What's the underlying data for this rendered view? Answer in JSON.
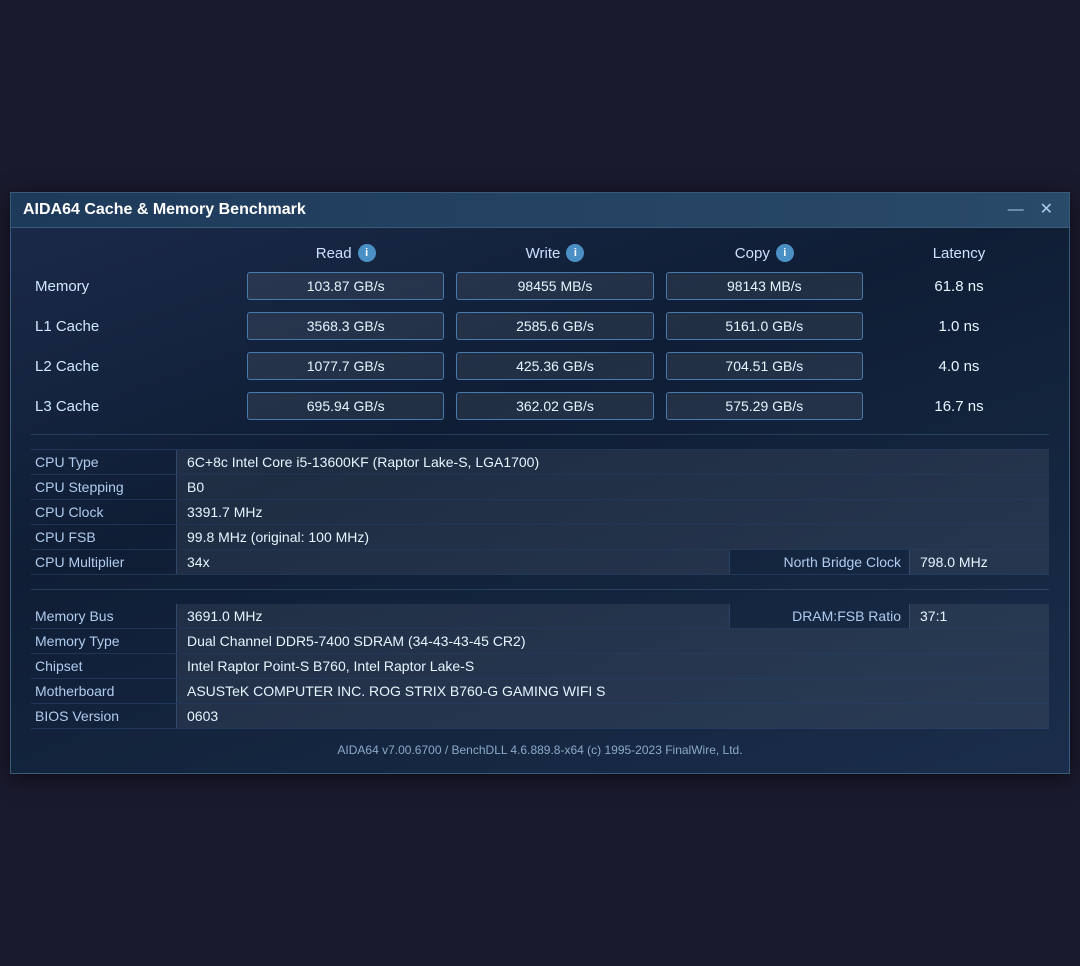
{
  "window": {
    "title": "AIDA64 Cache & Memory Benchmark"
  },
  "header": {
    "col_label": "",
    "read_label": "Read",
    "write_label": "Write",
    "copy_label": "Copy",
    "latency_label": "Latency"
  },
  "rows": [
    {
      "label": "Memory",
      "read": "103.87 GB/s",
      "write": "98455 MB/s",
      "copy": "98143 MB/s",
      "latency": "61.8 ns"
    },
    {
      "label": "L1 Cache",
      "read": "3568.3 GB/s",
      "write": "2585.6 GB/s",
      "copy": "5161.0 GB/s",
      "latency": "1.0 ns"
    },
    {
      "label": "L2 Cache",
      "read": "1077.7 GB/s",
      "write": "425.36 GB/s",
      "copy": "704.51 GB/s",
      "latency": "4.0 ns"
    },
    {
      "label": "L3 Cache",
      "read": "695.94 GB/s",
      "write": "362.02 GB/s",
      "copy": "575.29 GB/s",
      "latency": "16.7 ns"
    }
  ],
  "cpu_type_label": "CPU Type",
  "cpu_type_value": "6C+8c Intel Core i5-13600KF  (Raptor Lake-S, LGA1700)",
  "cpu_stepping_label": "CPU Stepping",
  "cpu_stepping_value": "B0",
  "cpu_clock_label": "CPU Clock",
  "cpu_clock_value": "3391.7 MHz",
  "cpu_fsb_label": "CPU FSB",
  "cpu_fsb_value": "99.8 MHz  (original: 100 MHz)",
  "cpu_mult_label": "CPU Multiplier",
  "cpu_mult_value": "34x",
  "nb_clock_label": "North Bridge Clock",
  "nb_clock_value": "798.0 MHz",
  "mem_bus_label": "Memory Bus",
  "mem_bus_value": "3691.0 MHz",
  "dram_ratio_label": "DRAM:FSB Ratio",
  "dram_ratio_value": "37:1",
  "mem_type_label": "Memory Type",
  "mem_type_value": "Dual Channel DDR5-7400 SDRAM  (34-43-43-45 CR2)",
  "chipset_label": "Chipset",
  "chipset_value": "Intel Raptor Point-S B760, Intel Raptor Lake-S",
  "motherboard_label": "Motherboard",
  "motherboard_value": "ASUSTeK COMPUTER INC. ROG STRIX B760-G GAMING WIFI S",
  "bios_label": "BIOS Version",
  "bios_value": "0603",
  "footer": "AIDA64 v7.00.6700 / BenchDLL 4.6.889.8-x64  (c) 1995-2023 FinalWire, Ltd.",
  "info_icon_label": "i"
}
